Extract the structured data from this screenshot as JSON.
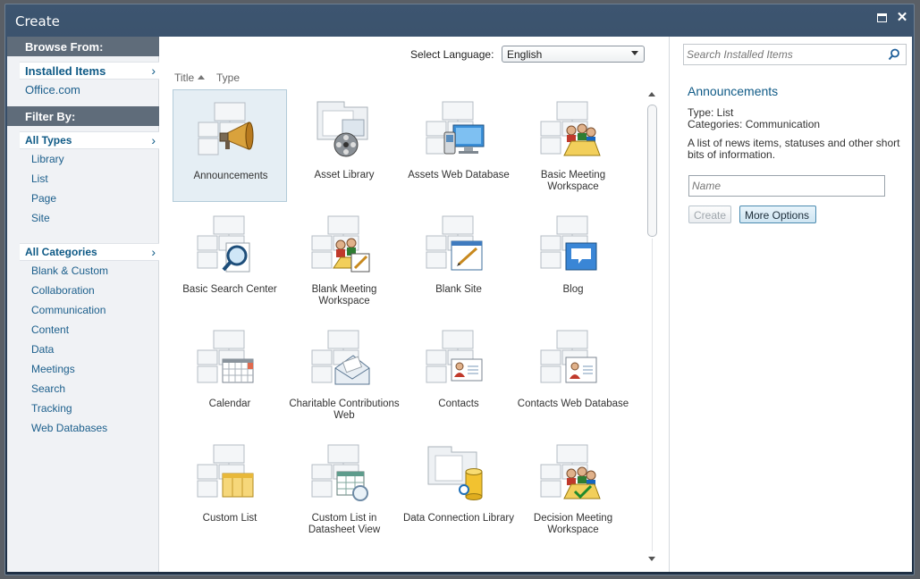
{
  "window": {
    "title": "Create"
  },
  "browse": {
    "header": "Browse From:",
    "selected": "Installed Items",
    "other": "Office.com"
  },
  "filter": {
    "header": "Filter By:",
    "types_selected": "All Types",
    "types": [
      "Library",
      "List",
      "Page",
      "Site"
    ],
    "categories_selected": "All Categories",
    "categories": [
      "Blank & Custom",
      "Collaboration",
      "Communication",
      "Content",
      "Data",
      "Meetings",
      "Search",
      "Tracking",
      "Web Databases"
    ]
  },
  "language": {
    "label": "Select Language:",
    "value": "English"
  },
  "sort": {
    "title": "Title",
    "type": "Type"
  },
  "templates": [
    {
      "label": "Announcements",
      "icon": "megaphone-icon"
    },
    {
      "label": "Asset Library",
      "icon": "media-reel-icon"
    },
    {
      "label": "Assets Web Database",
      "icon": "computer-phone-icon"
    },
    {
      "label": "Basic Meeting Workspace",
      "icon": "meeting-people-icon"
    },
    {
      "label": "Basic Search Center",
      "icon": "magnifier-icon"
    },
    {
      "label": "Blank Meeting Workspace",
      "icon": "meeting-edit-icon"
    },
    {
      "label": "Blank Site",
      "icon": "blank-page-pencil-icon"
    },
    {
      "label": "Blog",
      "icon": "speech-bubble-icon"
    },
    {
      "label": "Calendar",
      "icon": "calendar-icon"
    },
    {
      "label": "Charitable Contributions Web",
      "icon": "envelope-icon"
    },
    {
      "label": "Contacts",
      "icon": "contact-card-icon"
    },
    {
      "label": "Contacts Web Database",
      "icon": "contact-card-db-icon"
    },
    {
      "label": "Custom List",
      "icon": "custom-list-icon"
    },
    {
      "label": "Custom List in Datasheet View",
      "icon": "datasheet-icon"
    },
    {
      "label": "Data Connection Library",
      "icon": "database-cylinder-icon"
    },
    {
      "label": "Decision Meeting Workspace",
      "icon": "meeting-check-icon"
    }
  ],
  "details": {
    "search_placeholder": "Search Installed Items",
    "title": "Announcements",
    "type": "Type: List",
    "categories": "Categories: Communication",
    "description": "A list of news items, statuses and other short bits of information.",
    "name_placeholder": "Name",
    "create_label": "Create",
    "more_options_label": "More Options"
  },
  "colors": {
    "accent": "#0f5a86",
    "header_bar": "#5f6c7a",
    "selected_tile": "#e5eef4"
  }
}
